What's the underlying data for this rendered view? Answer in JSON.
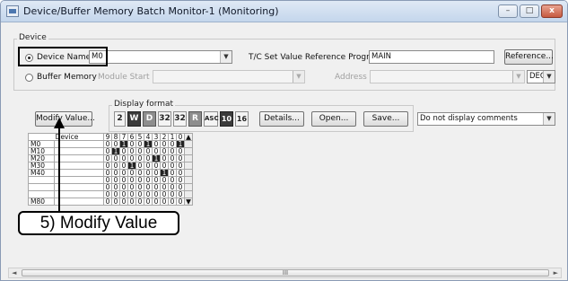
{
  "window": {
    "title": "Device/Buffer Memory Batch Monitor-1 (Monitoring)",
    "minimize": "–",
    "maximize": "□",
    "close": "x"
  },
  "device_group": {
    "label": "Device",
    "device_name": {
      "label": "Device Name",
      "value": "M0",
      "selected": true
    },
    "tc_ref_label": "T/C Set Value Reference Program",
    "tc_ref_value": "MAIN",
    "reference_button": "Reference...",
    "buffer_memory": {
      "label": "Buffer Memory",
      "module_start_label": "Module Start",
      "address_label": "Address",
      "radix": "DEC",
      "selected": false
    }
  },
  "display_format": {
    "label": "Display format",
    "modify_button": "Modify Value...",
    "buttons": [
      "2",
      "W",
      "D",
      "32",
      "32",
      "R",
      "ASC",
      "10",
      "16"
    ],
    "details_button": "Details...",
    "open_button": "Open...",
    "save_button": "Save...",
    "comment_select": "Do not display comments"
  },
  "grid": {
    "header": [
      "Device",
      "9",
      "8",
      "7",
      "6",
      "5",
      "4",
      "3",
      "2",
      "1",
      "0"
    ],
    "rows": [
      {
        "device": "M0",
        "bits": [
          0,
          0,
          1,
          0,
          0,
          1,
          0,
          0,
          0,
          1
        ]
      },
      {
        "device": "M10",
        "bits": [
          0,
          1,
          0,
          0,
          0,
          0,
          0,
          0,
          0,
          0
        ]
      },
      {
        "device": "M20",
        "bits": [
          0,
          0,
          0,
          0,
          0,
          0,
          1,
          0,
          0,
          0
        ]
      },
      {
        "device": "M30",
        "bits": [
          0,
          0,
          0,
          1,
          0,
          0,
          0,
          0,
          0,
          0
        ]
      },
      {
        "device": "M40",
        "bits": [
          0,
          0,
          0,
          0,
          0,
          0,
          0,
          1,
          0,
          0
        ]
      },
      {
        "device": "",
        "bits": [
          0,
          0,
          0,
          0,
          0,
          0,
          0,
          0,
          0,
          0
        ]
      },
      {
        "device": "",
        "bits": [
          0,
          0,
          0,
          0,
          0,
          0,
          0,
          0,
          0,
          0
        ]
      },
      {
        "device": "",
        "bits": [
          0,
          0,
          0,
          0,
          0,
          0,
          0,
          0,
          0,
          0
        ]
      },
      {
        "device": "M80",
        "bits": [
          0,
          0,
          0,
          0,
          0,
          0,
          0,
          0,
          0,
          0
        ]
      }
    ]
  },
  "annotation": {
    "text": "5) Modify Value"
  },
  "scrollbar": {
    "grip": "III"
  }
}
